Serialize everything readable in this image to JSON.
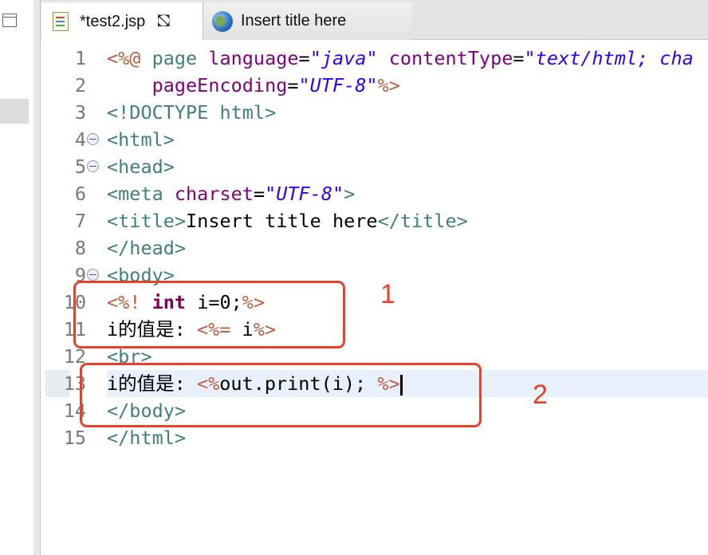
{
  "tabs": [
    {
      "label": "*test2.jsp",
      "icon": "jsp-file-icon",
      "active": true
    },
    {
      "label": "Insert title here",
      "icon": "globe-icon",
      "active": false
    }
  ],
  "code_lines": [
    {
      "n": "1",
      "tokens": [
        [
          "jsp",
          "<%@ "
        ],
        [
          "tag",
          "page "
        ],
        [
          "attr",
          "language"
        ],
        [
          "txt",
          "="
        ],
        [
          "val",
          "\"java\""
        ],
        [
          "txt",
          " "
        ],
        [
          "attr",
          "contentType"
        ],
        [
          "txt",
          "="
        ],
        [
          "val",
          "\"text/html; cha"
        ]
      ]
    },
    {
      "n": "2",
      "tokens": [
        [
          "txt",
          "    "
        ],
        [
          "attr",
          "pageEncoding"
        ],
        [
          "txt",
          "="
        ],
        [
          "val",
          "\"UTF-8\""
        ],
        [
          "jsp",
          "%>"
        ]
      ]
    },
    {
      "n": "3",
      "tokens": [
        [
          "tag",
          "<!DOCTYPE html>"
        ]
      ]
    },
    {
      "n": "4",
      "fold": true,
      "tokens": [
        [
          "tag",
          "<html>"
        ]
      ]
    },
    {
      "n": "5",
      "fold": true,
      "tokens": [
        [
          "tag",
          "<head>"
        ]
      ]
    },
    {
      "n": "6",
      "tokens": [
        [
          "tag",
          "<meta "
        ],
        [
          "attr",
          "charset"
        ],
        [
          "txt",
          "="
        ],
        [
          "val",
          "\"UTF-8\""
        ],
        [
          "tag",
          ">"
        ]
      ]
    },
    {
      "n": "7",
      "tokens": [
        [
          "tag",
          "<title>"
        ],
        [
          "txt",
          "Insert title here"
        ],
        [
          "tag",
          "</title>"
        ]
      ]
    },
    {
      "n": "8",
      "tokens": [
        [
          "tag",
          "</head>"
        ]
      ]
    },
    {
      "n": "9",
      "fold": true,
      "tokens": [
        [
          "tag",
          "<body>"
        ]
      ]
    },
    {
      "n": "10",
      "tokens": [
        [
          "jsp",
          "<%! "
        ],
        [
          "kw",
          "int"
        ],
        [
          "txt",
          " i=0;"
        ],
        [
          "jsp",
          "%>"
        ]
      ]
    },
    {
      "n": "11",
      "tokens": [
        [
          "txt",
          "i的值是: "
        ],
        [
          "jsp",
          "<%= "
        ],
        [
          "txt",
          "i"
        ],
        [
          "jsp",
          "%>"
        ]
      ]
    },
    {
      "n": "12",
      "tokens": [
        [
          "tag",
          "<br>"
        ]
      ]
    },
    {
      "n": "13",
      "current": true,
      "tokens": [
        [
          "txt",
          "i的值是: "
        ],
        [
          "jsp",
          "<%"
        ],
        [
          "txt",
          "out.print(i); "
        ],
        [
          "jsp",
          "%>"
        ]
      ]
    },
    {
      "n": "14",
      "tokens": [
        [
          "tag",
          "</body>"
        ]
      ]
    },
    {
      "n": "15",
      "tokens": [
        [
          "tag",
          "</html>"
        ]
      ]
    }
  ],
  "annotations": [
    {
      "label": "1"
    },
    {
      "label": "2"
    }
  ],
  "colors": {
    "annotation": "#e8412c",
    "current_line": "#e8f0fc"
  }
}
